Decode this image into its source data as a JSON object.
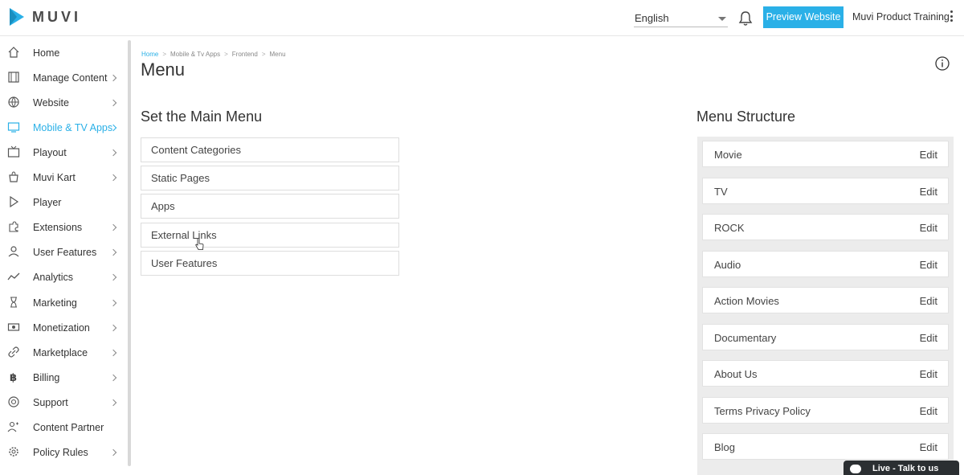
{
  "header": {
    "brand": "MUVI",
    "language": "English",
    "preview_button": "Preview Website",
    "account_name": "Muvi Product Training",
    "brand_color": "#2ab0e7"
  },
  "sidebar": {
    "items": [
      {
        "label": "Home",
        "icon": "home-icon",
        "has_children": false
      },
      {
        "label": "Manage Content",
        "icon": "film-icon",
        "has_children": true
      },
      {
        "label": "Website",
        "icon": "globe-icon",
        "has_children": true
      },
      {
        "label": "Mobile & TV Apps",
        "icon": "monitor-icon",
        "has_children": true,
        "active": true
      },
      {
        "label": "Playout",
        "icon": "tv-icon",
        "has_children": true
      },
      {
        "label": "Muvi Kart",
        "icon": "bag-icon",
        "has_children": true
      },
      {
        "label": "Player",
        "icon": "play-icon",
        "has_children": false
      },
      {
        "label": "Extensions",
        "icon": "puzzle-icon",
        "has_children": true
      },
      {
        "label": "User Features",
        "icon": "user-icon",
        "has_children": true
      },
      {
        "label": "Analytics",
        "icon": "trend-icon",
        "has_children": true
      },
      {
        "label": "Marketing",
        "icon": "hourglass-icon",
        "has_children": true
      },
      {
        "label": "Monetization",
        "icon": "money-icon",
        "has_children": true
      },
      {
        "label": "Marketplace",
        "icon": "link-icon",
        "has_children": true
      },
      {
        "label": "Billing",
        "icon": "bitcoin-icon",
        "has_children": true
      },
      {
        "label": "Support",
        "icon": "lifebuoy-icon",
        "has_children": true
      },
      {
        "label": "Content Partner",
        "icon": "partner-icon",
        "has_children": false
      },
      {
        "label": "Policy Rules",
        "icon": "gear-icon",
        "has_children": true
      }
    ]
  },
  "breadcrumb": [
    "Home",
    "Mobile & Tv Apps",
    "Frontend",
    "Menu"
  ],
  "page_title": "Menu",
  "main_menu": {
    "title": "Set the Main Menu",
    "items": [
      "Content Categories",
      "Static Pages",
      "Apps",
      "External Links",
      "User Features"
    ]
  },
  "menu_structure": {
    "title": "Menu Structure",
    "edit_label": "Edit",
    "items": [
      "Movie",
      "TV",
      "ROCK",
      "Audio",
      "Action Movies",
      "Documentary",
      "About Us",
      "Terms Privacy Policy",
      "Blog"
    ]
  },
  "chat": {
    "label": "Live - Talk to us"
  }
}
